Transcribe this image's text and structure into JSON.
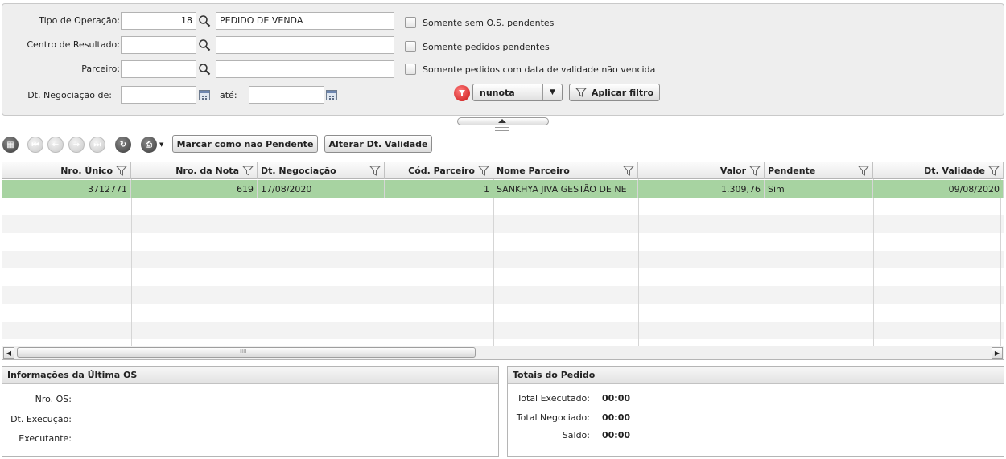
{
  "filters": {
    "tipo_operacao": {
      "label": "Tipo de Operação:",
      "code": "18",
      "description": "PEDIDO DE VENDA"
    },
    "centro_resultado": {
      "label": "Centro de Resultado:",
      "code": "",
      "description": ""
    },
    "parceiro": {
      "label": "Parceiro:",
      "code": "",
      "description": ""
    },
    "dt_negociacao": {
      "label": "Dt. Negociação de:",
      "from": "",
      "ate_label": "até:",
      "to": ""
    },
    "checkboxes": [
      {
        "label": "Somente sem O.S. pendentes",
        "checked": false
      },
      {
        "label": "Somente pedidos pendentes",
        "checked": false
      },
      {
        "label": "Somente pedidos com data de validade não vencida",
        "checked": false
      }
    ],
    "order_field": "nunota",
    "apply_label": "Aplicar filtro"
  },
  "toolbar": {
    "mark_not_pending_label": "Marcar como não Pendente",
    "change_validity_label": "Alterar Dt. Validade"
  },
  "grid": {
    "columns": [
      "Nro. Único",
      "Nro. da Nota",
      "Dt. Negociação",
      "Cód. Parceiro",
      "Nome Parceiro",
      "Valor",
      "Pendente",
      "Dt. Validade"
    ],
    "rows": [
      [
        "3712771",
        "619",
        "17/08/2020",
        "1",
        "SANKHYA JIVA GESTÃO DE NE",
        "1.309,76",
        "Sim",
        "09/08/2020"
      ]
    ]
  },
  "last_os": {
    "title": "Informações da Última OS",
    "labels": [
      "Nro. OS:",
      "Dt. Execução:",
      "Executante:"
    ]
  },
  "totals": {
    "title": "Totais do Pedido",
    "items": [
      {
        "label": "Total Executado:",
        "value": "00:00"
      },
      {
        "label": "Total Negociado:",
        "value": "00:00"
      },
      {
        "label": "Saldo:",
        "value": "00:00"
      }
    ]
  },
  "colors": {
    "selected_row": "#a7d3a1",
    "panel_bg": "#eeeeee"
  }
}
